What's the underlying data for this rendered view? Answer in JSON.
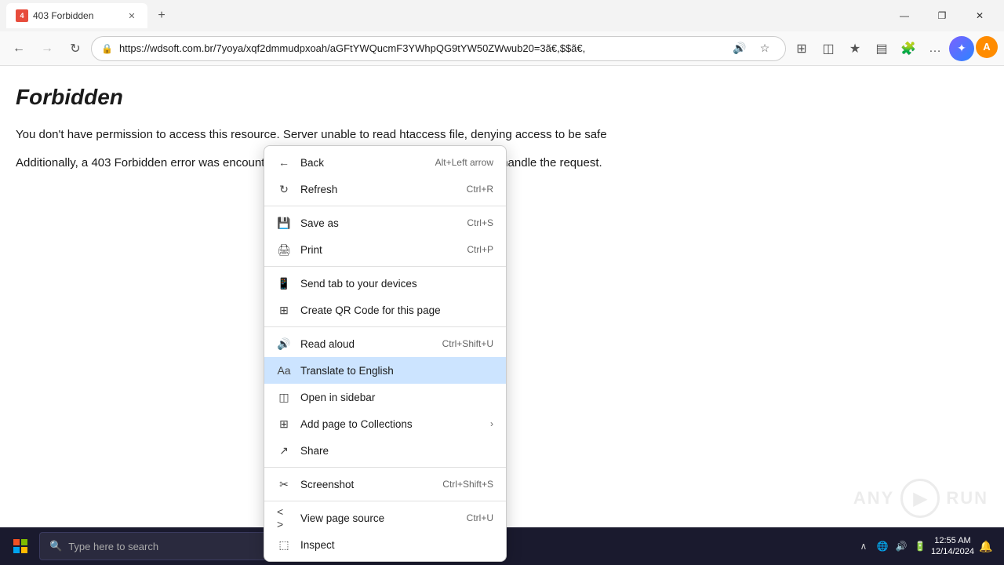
{
  "titlebar": {
    "tab_title": "403 Forbidden",
    "tab_icon_text": "4",
    "new_tab_label": "+",
    "window_controls": {
      "minimize": "—",
      "maximize": "❐",
      "close": "✕"
    }
  },
  "navbar": {
    "back_btn": "←",
    "forward_btn": "→",
    "refresh_btn": "↻",
    "address": "https://wdsoft.com.br/7yoya/xqf2dmmudpxoah/aGFtYWQucmF3YWhpQG9tYW50ZWwub20=3ã€,$$ã€,",
    "read_aloud_icon": "🔊",
    "favorites_icon": "☆",
    "browser_icon": "⊞",
    "split_icon": "⊟",
    "favorites_bar_icon": "★",
    "collections_icon": "▤",
    "extensions_icon": "🧩",
    "settings_icon": "…",
    "copilot_icon": "✦",
    "profile_initial": "A"
  },
  "page": {
    "title": "Forbidden",
    "text1": "You don't have permission to access this resource. Server unable to read htaccess file, denying access to be safe",
    "text2": "Additionally, a 403 Forbidden error was encountered while trying to use an ErrorDocument to handle the request."
  },
  "context_menu": {
    "items": [
      {
        "id": "back",
        "icon": "←",
        "label": "Back",
        "shortcut": "Alt+Left arrow",
        "highlighted": false,
        "has_arrow": false
      },
      {
        "id": "refresh",
        "icon": "↻",
        "label": "Refresh",
        "shortcut": "Ctrl+R",
        "highlighted": false,
        "has_arrow": false
      },
      {
        "id": "divider1",
        "type": "divider"
      },
      {
        "id": "save-as",
        "icon": "💾",
        "label": "Save as",
        "shortcut": "Ctrl+S",
        "highlighted": false,
        "has_arrow": false
      },
      {
        "id": "print",
        "icon": "🖨",
        "label": "Print",
        "shortcut": "Ctrl+P",
        "highlighted": false,
        "has_arrow": false
      },
      {
        "id": "divider2",
        "type": "divider"
      },
      {
        "id": "send-tab",
        "icon": "📱",
        "label": "Send tab to your devices",
        "shortcut": "",
        "highlighted": false,
        "has_arrow": false
      },
      {
        "id": "create-qr",
        "icon": "⊞",
        "label": "Create QR Code for this page",
        "shortcut": "",
        "highlighted": false,
        "has_arrow": false
      },
      {
        "id": "divider3",
        "type": "divider"
      },
      {
        "id": "read-aloud",
        "icon": "🔊",
        "label": "Read aloud",
        "shortcut": "Ctrl+Shift+U",
        "highlighted": false,
        "has_arrow": false
      },
      {
        "id": "translate",
        "icon": "Aa",
        "label": "Translate to English",
        "shortcut": "",
        "highlighted": true,
        "has_arrow": false
      },
      {
        "id": "open-sidebar",
        "icon": "◫",
        "label": "Open in sidebar",
        "shortcut": "",
        "highlighted": false,
        "has_arrow": false
      },
      {
        "id": "add-collections",
        "icon": "⊞",
        "label": "Add page to Collections",
        "shortcut": "",
        "highlighted": false,
        "has_arrow": true
      },
      {
        "id": "share",
        "icon": "↗",
        "label": "Share",
        "shortcut": "",
        "highlighted": false,
        "has_arrow": false
      },
      {
        "id": "divider4",
        "type": "divider"
      },
      {
        "id": "screenshot",
        "icon": "✂",
        "label": "Screenshot",
        "shortcut": "Ctrl+Shift+S",
        "highlighted": false,
        "has_arrow": false
      },
      {
        "id": "divider5",
        "type": "divider"
      },
      {
        "id": "view-source",
        "icon": "< >",
        "label": "View page source",
        "shortcut": "Ctrl+U",
        "highlighted": false,
        "has_arrow": false
      },
      {
        "id": "inspect",
        "icon": "⬚",
        "label": "Inspect",
        "shortcut": "",
        "highlighted": false,
        "has_arrow": false
      }
    ]
  },
  "taskbar": {
    "search_placeholder": "Type here to search",
    "items": [
      {
        "id": "task-view",
        "icon": "⊞",
        "active": false
      },
      {
        "id": "edge",
        "icon": "🌊",
        "active": true
      },
      {
        "id": "files",
        "icon": "📁",
        "active": false
      },
      {
        "id": "firefox",
        "icon": "🦊",
        "active": false
      }
    ],
    "tray": {
      "time": "12:55 AM",
      "date": "12/14/2024",
      "notification_icon": "🔔"
    }
  },
  "watermark": {
    "text": "ANY RUN"
  }
}
